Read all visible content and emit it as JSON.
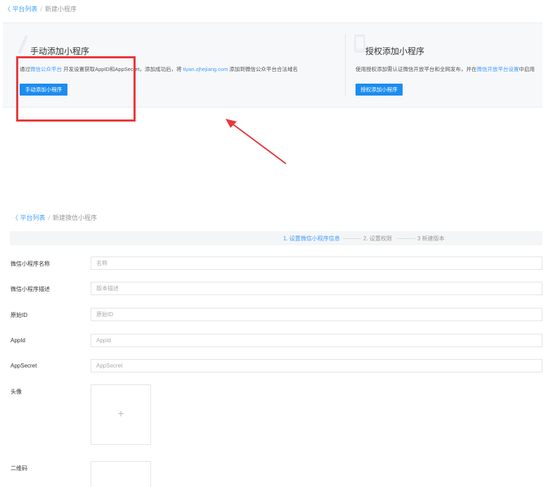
{
  "top": {
    "breadcrumb": {
      "back_link": "〈 平台列表",
      "separator": "/",
      "current": "新建小程序"
    },
    "manual": {
      "title": "手动添加小程序",
      "desc_prefix": "通过",
      "desc_link": "微信公众平台",
      "desc_middle": " 开发设置获取AppID和AppSecret，添加成功后，将 ",
      "desc_domain": "tiyan.zjhejiang.com",
      "desc_suffix": " 添加到微信公众平台合法域名",
      "button": "手动添加小程序"
    },
    "auth": {
      "title": "授权添加小程序",
      "desc_prefix": "使用授权添加需认证微信开放平台和全网发布，并在",
      "desc_link": "微信开放平台设置",
      "desc_suffix": "中启用",
      "button": "授权添加小程序"
    }
  },
  "bottom": {
    "breadcrumb": {
      "back_link": "〈 平台列表",
      "separator": "/",
      "current": "新建微信小程序"
    },
    "steps": [
      {
        "label": "1. 设置微信小程序信息",
        "active": true
      },
      {
        "label": "2. 设置权限",
        "active": false
      },
      {
        "label": "3 新建版本",
        "active": false
      }
    ],
    "form": {
      "name_label": "微信小程序名称",
      "name_placeholder": "名称",
      "desc_label": "微信小程序描述",
      "desc_placeholder": "版本描述",
      "origin_label": "原始ID",
      "origin_placeholder": "原始ID",
      "appid_label": "AppId",
      "appid_placeholder": "AppId",
      "secret_label": "AppSecret",
      "secret_placeholder": "AppSecret",
      "avatar_label": "头像",
      "avatar_plus": "+",
      "qrcode_label": "二维码"
    }
  },
  "colors": {
    "accent": "#409eff",
    "button": "#1c8cf0",
    "annotation": "#e8383d"
  },
  "icons": {
    "manual_icon": "pen-icon",
    "auth_icon": "phone-icon",
    "upload_icon": "plus-icon"
  }
}
